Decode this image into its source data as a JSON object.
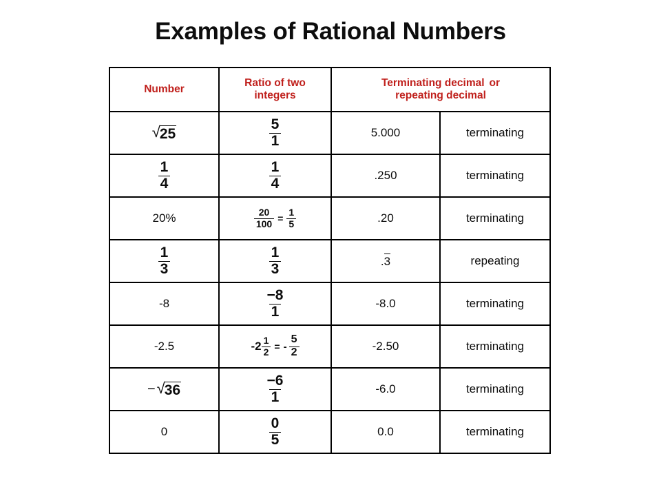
{
  "slide": {
    "title": "Examples of Rational Numbers",
    "accent_color": "#C0201C",
    "text_color": "#0D0D0D",
    "background_color": "#FFFFFF"
  },
  "table": {
    "headers": {
      "number": "Number",
      "ratio_line1": "Ratio of two",
      "ratio_line2": "integers",
      "decimal_line1": "Terminating decimal",
      "decimal_or": "or",
      "decimal_line2": "repeating decimal"
    },
    "rows": [
      {
        "number": {
          "kind": "radical",
          "sign": "",
          "radical": "√",
          "radicand": "25",
          "text": "√25"
        },
        "ratio": {
          "kind": "fraction",
          "numerator": "5",
          "denominator": "1",
          "text": "5/1"
        },
        "decimal": "5.000",
        "type": "terminating"
      },
      {
        "number": {
          "kind": "fraction",
          "numerator": "1",
          "denominator": "4",
          "text": "1/4"
        },
        "ratio": {
          "kind": "fraction",
          "numerator": "1",
          "denominator": "4",
          "text": "1/4"
        },
        "decimal": ".250",
        "type": "terminating"
      },
      {
        "number": {
          "kind": "plain",
          "text": "20%"
        },
        "ratio": {
          "kind": "fraction-equals-fraction",
          "left_numerator": "20",
          "left_denominator": "100",
          "equals": "=",
          "right_numerator": "1",
          "right_denominator": "5",
          "text": "20/100 = 1/5"
        },
        "decimal": ".20",
        "type": "terminating"
      },
      {
        "number": {
          "kind": "fraction",
          "numerator": "1",
          "denominator": "3",
          "text": "1/3"
        },
        "ratio": {
          "kind": "fraction",
          "numerator": "1",
          "denominator": "3",
          "text": "1/3"
        },
        "decimal": {
          "kind": "repeating",
          "prefix": ".",
          "repeating_digits": "3",
          "text": ".3 repeating"
        },
        "type": "repeating"
      },
      {
        "number": {
          "kind": "plain",
          "text": "-8"
        },
        "ratio": {
          "kind": "fraction",
          "numerator": "−8",
          "denominator": "1",
          "text": "-8/1"
        },
        "decimal": "-8.0",
        "type": "terminating"
      },
      {
        "number": {
          "kind": "plain",
          "text": "-2.5"
        },
        "ratio": {
          "kind": "mixed-equals-fraction",
          "whole": "-2",
          "left_numerator": "1",
          "left_denominator": "2",
          "equals": "=",
          "right_sign": "-",
          "right_numerator": "5",
          "right_denominator": "2",
          "text": "-2 1/2 = - 5/2"
        },
        "decimal": "-2.50",
        "type": "terminating"
      },
      {
        "number": {
          "kind": "radical",
          "sign": "−",
          "radical": "√",
          "radicand": "36",
          "text": "−√36"
        },
        "ratio": {
          "kind": "fraction",
          "numerator": "−6",
          "denominator": "1",
          "text": "-6/1"
        },
        "decimal": "-6.0",
        "type": "terminating"
      },
      {
        "number": {
          "kind": "plain",
          "text": "0"
        },
        "ratio": {
          "kind": "fraction",
          "numerator": "0",
          "denominator": "5",
          "text": "0/5"
        },
        "decimal": "0.0",
        "type": "terminating"
      }
    ]
  }
}
